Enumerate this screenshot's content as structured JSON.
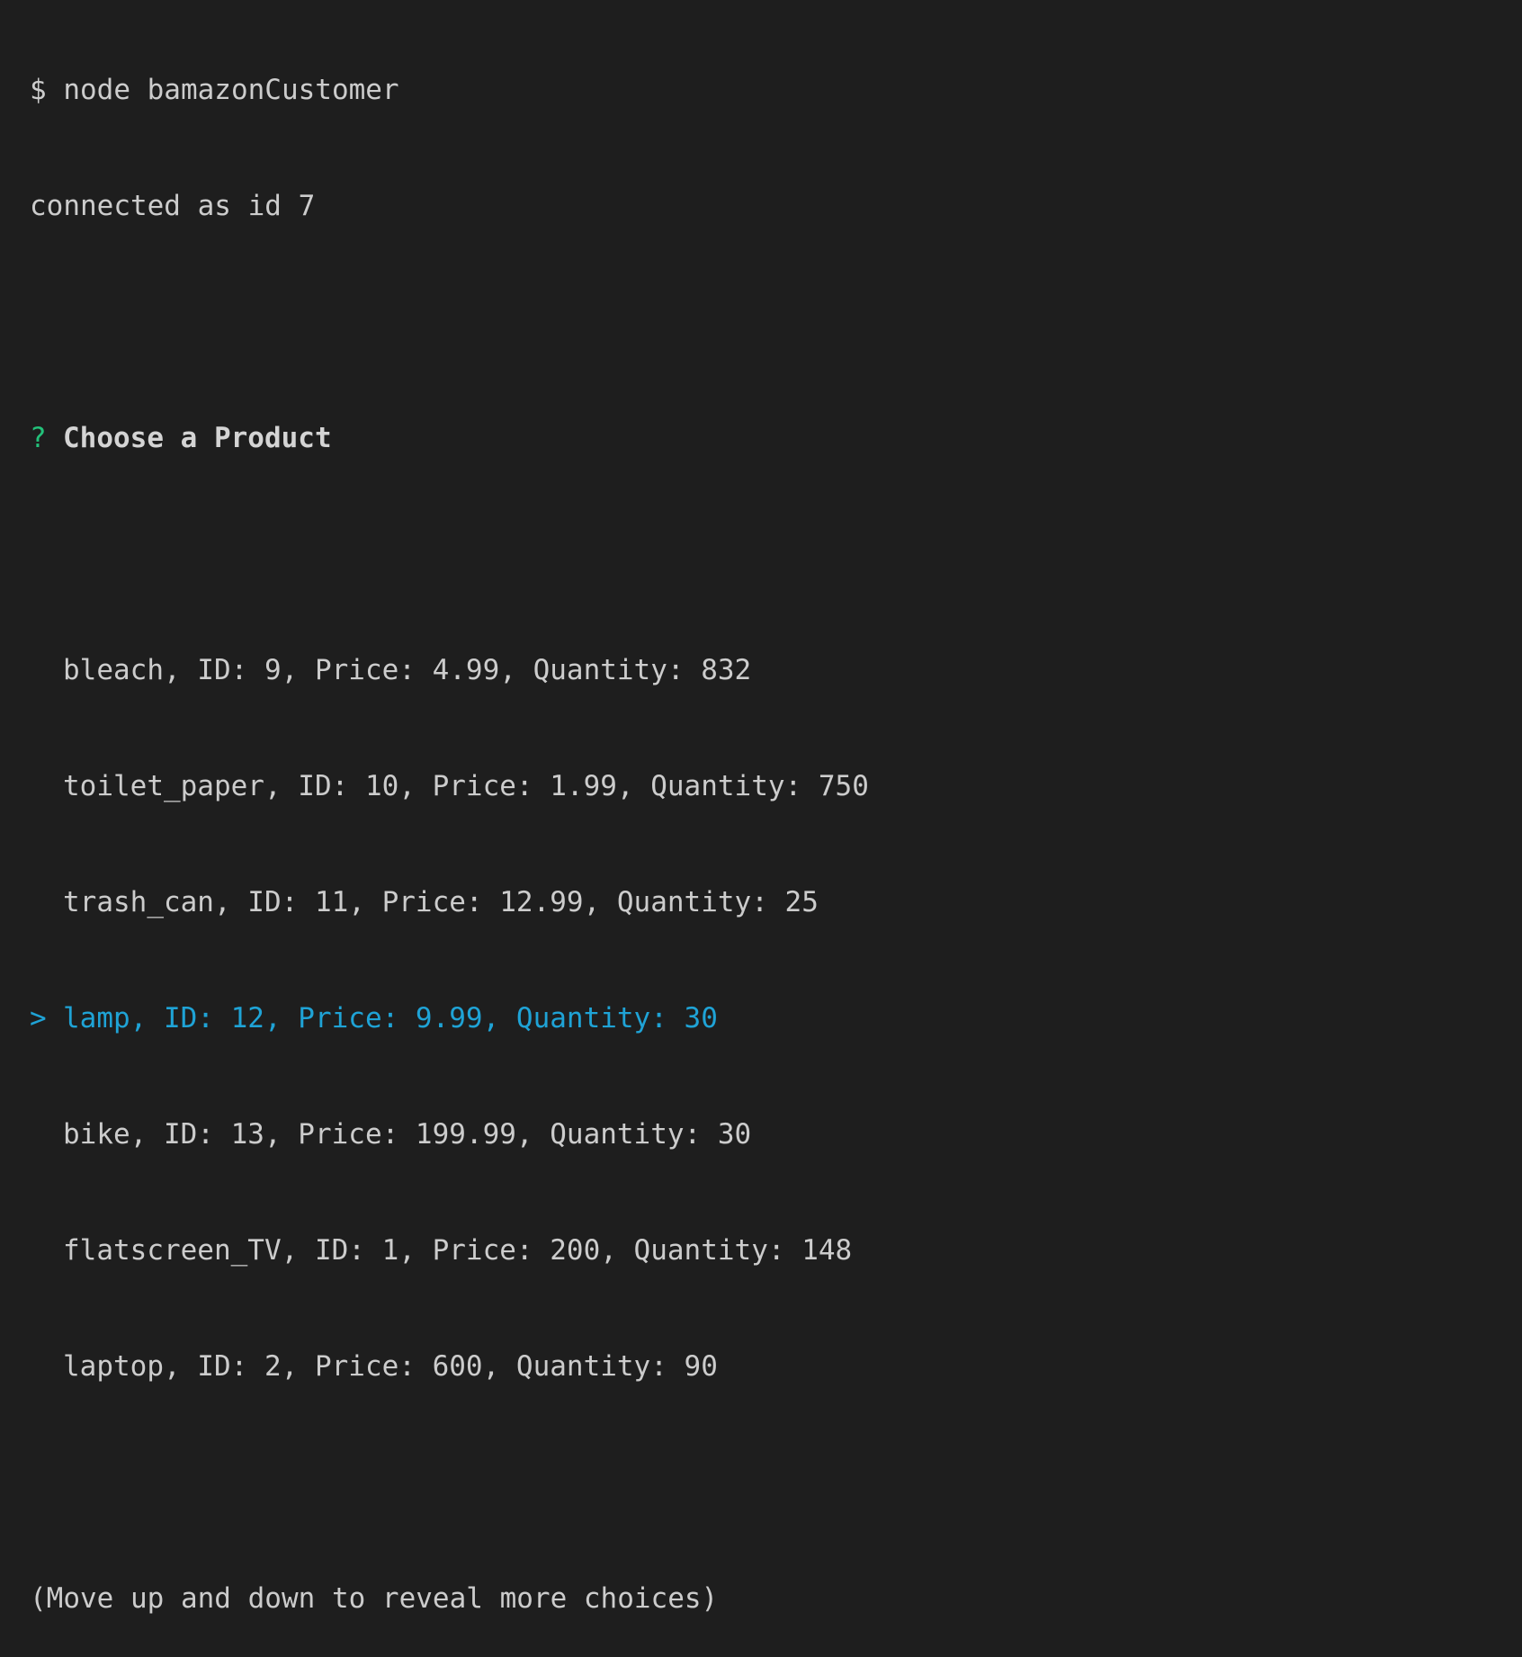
{
  "terminal": {
    "command_line": "$ node bamazonCustomer",
    "connection_line": "connected as id 7",
    "prompt": {
      "qmark": "?",
      "question": "Choose a Product",
      "pointer": ">",
      "selected_index": 3,
      "choices": [
        "bleach, ID: 9, Price: 4.99, Quantity: 832",
        "toilet_paper, ID: 10, Price: 1.99, Quantity: 750",
        "trash_can, ID: 11, Price: 12.99, Quantity: 25",
        "lamp, ID: 12, Price: 9.99, Quantity: 30",
        "bike, ID: 13, Price: 199.99, Quantity: 30",
        "flatscreen_TV, ID: 1, Price: 200, Quantity: 148",
        "laptop, ID: 2, Price: 600, Quantity: 90"
      ],
      "hint": "(Move up and down to reveal more choices)"
    },
    "colors": {
      "background": "#1e1e1e",
      "text": "#cccccc",
      "qmark": "#23c17a",
      "selected": "#1fa3d6"
    }
  }
}
